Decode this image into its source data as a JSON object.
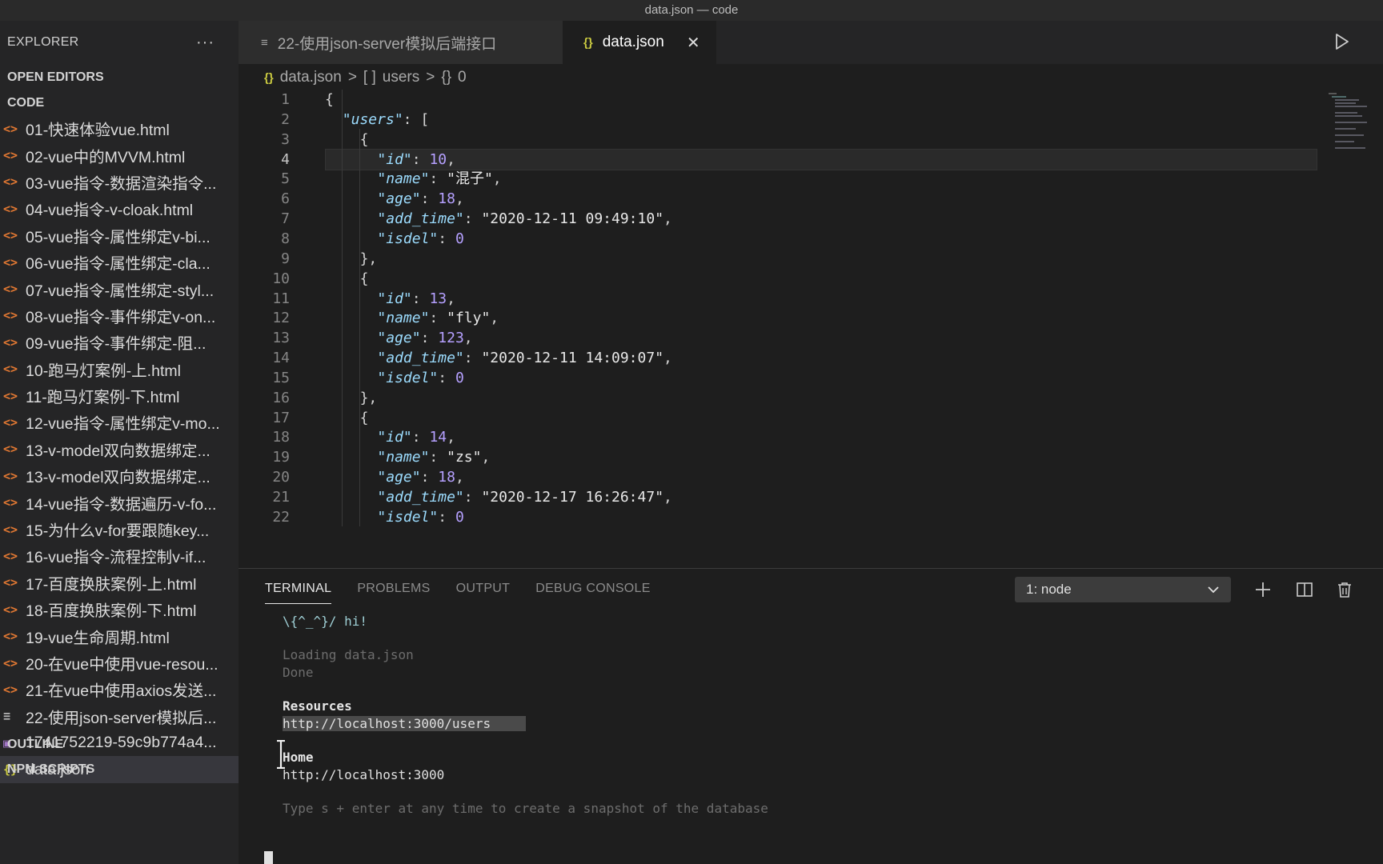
{
  "window": {
    "title": "data.json — code"
  },
  "sidebar": {
    "title": "EXPLORER",
    "more": "···",
    "open_editors": "OPEN EDITORS",
    "folder": "CODE",
    "files": [
      {
        "icon": "<>",
        "type": "html",
        "name": "01-快速体验vue.html"
      },
      {
        "icon": "<>",
        "type": "html",
        "name": "02-vue中的MVVM.html"
      },
      {
        "icon": "<>",
        "type": "html",
        "name": "03-vue指令-数据渲染指令..."
      },
      {
        "icon": "<>",
        "type": "html",
        "name": "04-vue指令-v-cloak.html"
      },
      {
        "icon": "<>",
        "type": "html",
        "name": "05-vue指令-属性绑定v-bi..."
      },
      {
        "icon": "<>",
        "type": "html",
        "name": "06-vue指令-属性绑定-cla..."
      },
      {
        "icon": "<>",
        "type": "html",
        "name": "07-vue指令-属性绑定-styl..."
      },
      {
        "icon": "<>",
        "type": "html",
        "name": "08-vue指令-事件绑定v-on..."
      },
      {
        "icon": "<>",
        "type": "html",
        "name": "09-vue指令-事件绑定-阻..."
      },
      {
        "icon": "<>",
        "type": "html",
        "name": "10-跑马灯案例-上.html"
      },
      {
        "icon": "<>",
        "type": "html",
        "name": "11-跑马灯案例-下.html"
      },
      {
        "icon": "<>",
        "type": "html",
        "name": "12-vue指令-属性绑定v-mo..."
      },
      {
        "icon": "<>",
        "type": "html",
        "name": "13-v-model双向数据绑定..."
      },
      {
        "icon": "<>",
        "type": "html",
        "name": "13-v-model双向数据绑定..."
      },
      {
        "icon": "<>",
        "type": "html",
        "name": "14-vue指令-数据遍历-v-fo..."
      },
      {
        "icon": "<>",
        "type": "html",
        "name": "15-为什么v-for要跟随key..."
      },
      {
        "icon": "<>",
        "type": "html",
        "name": "16-vue指令-流程控制v-if..."
      },
      {
        "icon": "<>",
        "type": "html",
        "name": "17-百度换肤案例-上.html"
      },
      {
        "icon": "<>",
        "type": "html",
        "name": "18-百度换肤案例-下.html"
      },
      {
        "icon": "<>",
        "type": "html",
        "name": "19-vue生命周期.html"
      },
      {
        "icon": "<>",
        "type": "html",
        "name": "20-在vue中使用vue-resou..."
      },
      {
        "icon": "<>",
        "type": "html",
        "name": "21-在vue中使用axios发送..."
      },
      {
        "icon": "≡",
        "type": "md",
        "name": "22-使用json-server模拟后..."
      },
      {
        "icon": "▣",
        "type": "img",
        "name": "1741752219-59c9b774a4..."
      },
      {
        "icon": "{}",
        "type": "json",
        "name": "data.json"
      }
    ],
    "outline": "OUTLINE",
    "npm_scripts": "NPM SCRIPTS"
  },
  "tabs": [
    {
      "icon": "≡",
      "label": "22-使用json-server模拟后端接口"
    },
    {
      "icon": "{}",
      "label": "data.json",
      "close": "✕"
    }
  ],
  "breadcrumb": {
    "file_icon": "{}",
    "file": "data.json",
    "sep": ">",
    "users_icon": "[ ]",
    "users": "users",
    "item_icon": "{}",
    "item": "0"
  },
  "editor": {
    "current_line": 4,
    "lines": [
      {
        "n": "1",
        "indent": 0,
        "parts": [
          [
            "p",
            "{"
          ]
        ]
      },
      {
        "n": "2",
        "indent": 1,
        "parts": [
          [
            "k",
            "\"users\""
          ],
          [
            "p",
            ": ["
          ]
        ]
      },
      {
        "n": "3",
        "indent": 2,
        "parts": [
          [
            "p",
            "{"
          ]
        ]
      },
      {
        "n": "4",
        "indent": 3,
        "parts": [
          [
            "k",
            "\"id\""
          ],
          [
            "p",
            ": "
          ],
          [
            "n",
            "10"
          ],
          [
            "p",
            ","
          ]
        ]
      },
      {
        "n": "5",
        "indent": 3,
        "parts": [
          [
            "k",
            "\"name\""
          ],
          [
            "p",
            ": "
          ],
          [
            "s",
            "\"混子\""
          ],
          [
            "p",
            ","
          ]
        ]
      },
      {
        "n": "6",
        "indent": 3,
        "parts": [
          [
            "k",
            "\"age\""
          ],
          [
            "p",
            ": "
          ],
          [
            "n",
            "18"
          ],
          [
            "p",
            ","
          ]
        ]
      },
      {
        "n": "7",
        "indent": 3,
        "parts": [
          [
            "k",
            "\"add_time\""
          ],
          [
            "p",
            ": "
          ],
          [
            "s",
            "\"2020-12-11 09:49:10\""
          ],
          [
            "p",
            ","
          ]
        ]
      },
      {
        "n": "8",
        "indent": 3,
        "parts": [
          [
            "k",
            "\"isdel\""
          ],
          [
            "p",
            ": "
          ],
          [
            "n",
            "0"
          ]
        ]
      },
      {
        "n": "9",
        "indent": 2,
        "parts": [
          [
            "p",
            "},"
          ]
        ]
      },
      {
        "n": "10",
        "indent": 2,
        "parts": [
          [
            "p",
            "{"
          ]
        ]
      },
      {
        "n": "11",
        "indent": 3,
        "parts": [
          [
            "k",
            "\"id\""
          ],
          [
            "p",
            ": "
          ],
          [
            "n",
            "13"
          ],
          [
            "p",
            ","
          ]
        ]
      },
      {
        "n": "12",
        "indent": 3,
        "parts": [
          [
            "k",
            "\"name\""
          ],
          [
            "p",
            ": "
          ],
          [
            "s",
            "\"fly\""
          ],
          [
            "p",
            ","
          ]
        ]
      },
      {
        "n": "13",
        "indent": 3,
        "parts": [
          [
            "k",
            "\"age\""
          ],
          [
            "p",
            ": "
          ],
          [
            "n",
            "123"
          ],
          [
            "p",
            ","
          ]
        ]
      },
      {
        "n": "14",
        "indent": 3,
        "parts": [
          [
            "k",
            "\"add_time\""
          ],
          [
            "p",
            ": "
          ],
          [
            "s",
            "\"2020-12-11 14:09:07\""
          ],
          [
            "p",
            ","
          ]
        ]
      },
      {
        "n": "15",
        "indent": 3,
        "parts": [
          [
            "k",
            "\"isdel\""
          ],
          [
            "p",
            ": "
          ],
          [
            "n",
            "0"
          ]
        ]
      },
      {
        "n": "16",
        "indent": 2,
        "parts": [
          [
            "p",
            "},"
          ]
        ]
      },
      {
        "n": "17",
        "indent": 2,
        "parts": [
          [
            "p",
            "{"
          ]
        ]
      },
      {
        "n": "18",
        "indent": 3,
        "parts": [
          [
            "k",
            "\"id\""
          ],
          [
            "p",
            ": "
          ],
          [
            "n",
            "14"
          ],
          [
            "p",
            ","
          ]
        ]
      },
      {
        "n": "19",
        "indent": 3,
        "parts": [
          [
            "k",
            "\"name\""
          ],
          [
            "p",
            ": "
          ],
          [
            "s",
            "\"zs\""
          ],
          [
            "p",
            ","
          ]
        ]
      },
      {
        "n": "20",
        "indent": 3,
        "parts": [
          [
            "k",
            "\"age\""
          ],
          [
            "p",
            ": "
          ],
          [
            "n",
            "18"
          ],
          [
            "p",
            ","
          ]
        ]
      },
      {
        "n": "21",
        "indent": 3,
        "parts": [
          [
            "k",
            "\"add_time\""
          ],
          [
            "p",
            ": "
          ],
          [
            "s",
            "\"2020-12-17 16:26:47\""
          ],
          [
            "p",
            ","
          ]
        ]
      },
      {
        "n": "22",
        "indent": 3,
        "parts": [
          [
            "k",
            "\"isdel\""
          ],
          [
            "p",
            ": "
          ],
          [
            "n",
            "0"
          ]
        ]
      }
    ]
  },
  "panel": {
    "tabs": [
      "TERMINAL",
      "PROBLEMS",
      "OUTPUT",
      "DEBUG CONSOLE"
    ],
    "terminal_select": "1: node",
    "terminal": {
      "greeting": "\\{^_^}/ hi!",
      "loading": "Loading data.json",
      "done": "Done",
      "resources_heading": "Resources",
      "resources_url": "http://localhost:3000/users",
      "home_heading": "Home",
      "home_url": "http://localhost:3000",
      "hint": "Type s + enter at any time to create a snapshot of the database"
    }
  }
}
